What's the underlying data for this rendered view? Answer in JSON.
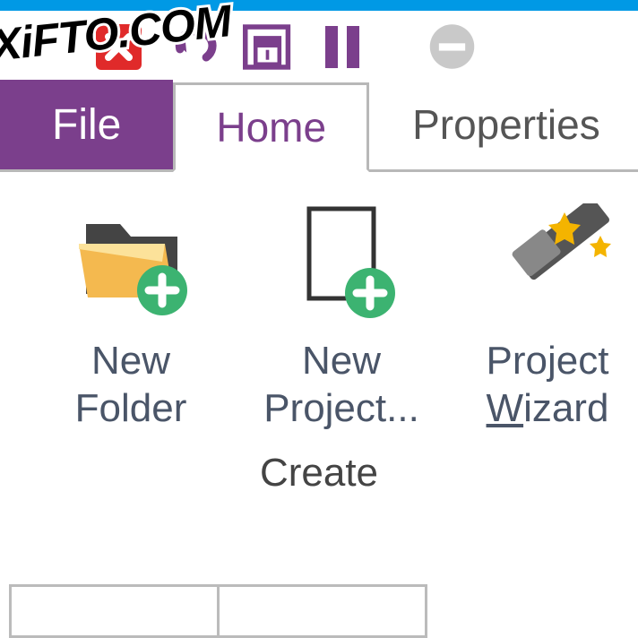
{
  "watermark": "XiFTO.COM",
  "colors": {
    "accent": "#7b3f8c",
    "titlebar": "#0099e5",
    "danger": "#e02a2a",
    "success": "#3cb371",
    "neutral": "#666"
  },
  "qat": {
    "close": "close",
    "undo": "undo",
    "save": "save",
    "pause": "pause",
    "minus": "minus"
  },
  "tabs": {
    "file": "File",
    "home": "Home",
    "properties": "Properties"
  },
  "ribbon": {
    "items": [
      {
        "label_line1": "New",
        "label_line2": "Folder"
      },
      {
        "label_line1": "New",
        "label_line2": "Project..."
      },
      {
        "label_line1": "Project",
        "label_line2_pre": "",
        "label_line2_u": "W",
        "label_line2_post": "izard"
      }
    ],
    "group_label": "Create"
  }
}
